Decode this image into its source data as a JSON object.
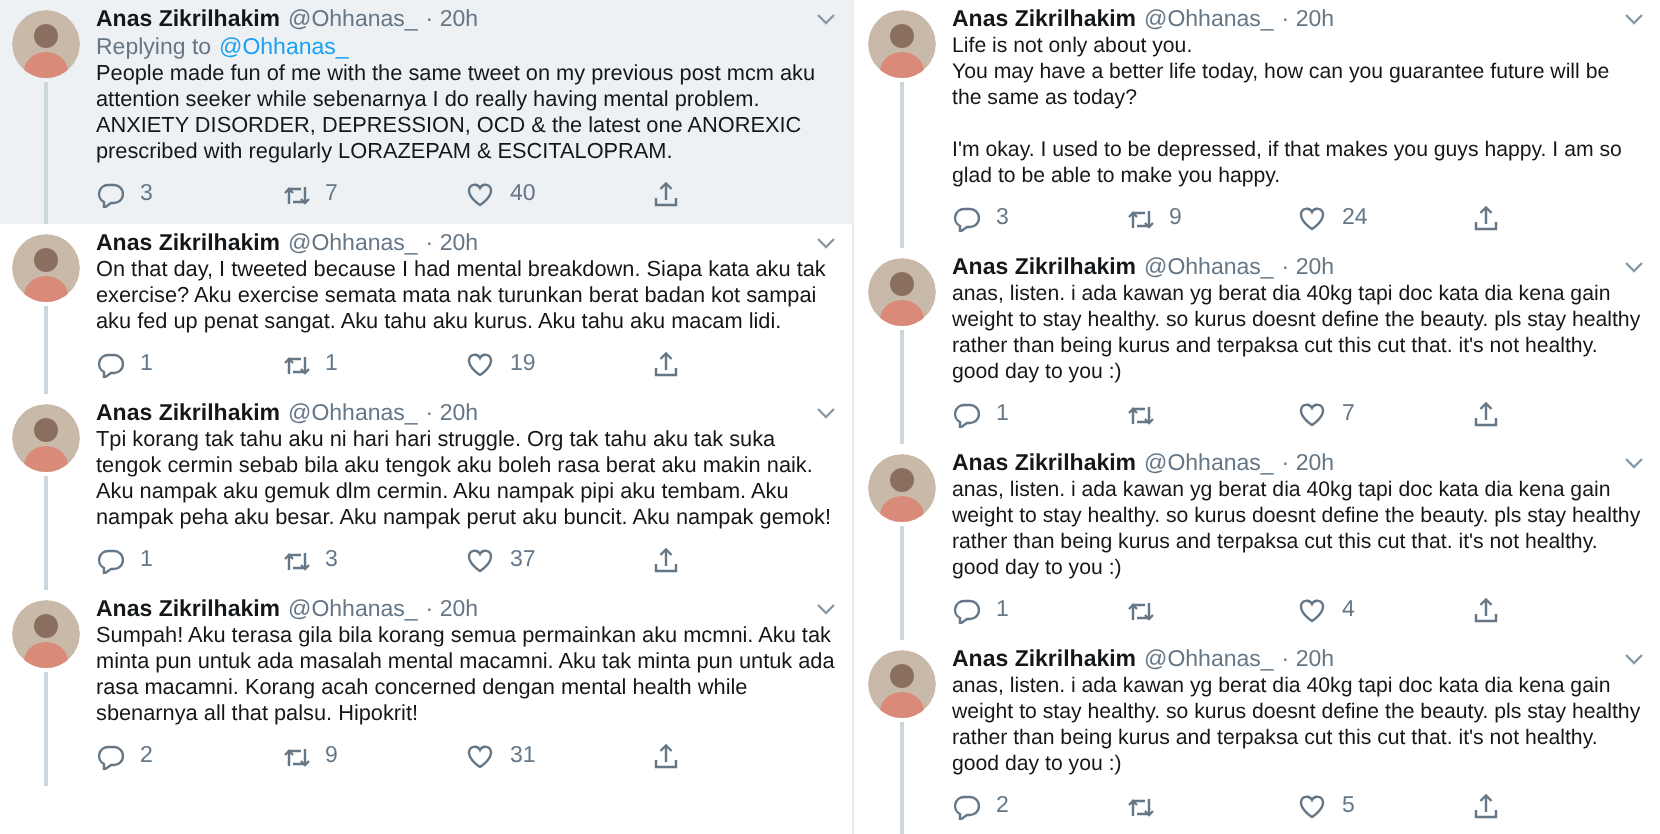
{
  "columns": [
    {
      "tweets": [
        {
          "name": "Anas Zikrilhakim",
          "handle": "@Ohhanas_",
          "time": "· 20h",
          "highlighted": true,
          "replying_to": {
            "label": "Replying to",
            "handle": "@Ohhanas_"
          },
          "text": "People made fun of me with the same tweet on my previous post mcm aku attention seeker while sebenarnya I do really having mental problem. ANXIETY DISORDER, DEPRESSION, OCD & the latest one ANOREXIC prescribed with regularly LORAZEPAM & ESCITALOPRAM.",
          "replies": "3",
          "retweets": "7",
          "likes": "40"
        },
        {
          "name": "Anas Zikrilhakim",
          "handle": "@Ohhanas_",
          "time": "· 20h",
          "highlighted": false,
          "text": "On that day, I tweeted because I had mental breakdown. Siapa kata aku tak exercise? Aku exercise semata mata nak turunkan berat badan kot sampai aku fed up penat sangat. Aku tahu aku kurus. Aku tahu aku macam lidi.",
          "replies": "1",
          "retweets": "1",
          "likes": "19"
        },
        {
          "name": "Anas Zikrilhakim",
          "handle": "@Ohhanas_",
          "time": "· 20h",
          "highlighted": false,
          "text": "Tpi korang tak tahu aku ni hari hari struggle. Org tak tahu aku tak suka tengok cermin sebab bila aku tengok aku boleh rasa berat aku makin naik. Aku nampak aku gemuk dlm cermin. Aku nampak pipi aku tembam. Aku nampak peha aku besar. Aku nampak perut aku buncit. Aku nampak gemok!",
          "replies": "1",
          "retweets": "3",
          "likes": "37"
        },
        {
          "name": "Anas Zikrilhakim",
          "handle": "@Ohhanas_",
          "time": "· 20h",
          "highlighted": false,
          "text": "Sumpah! Aku terasa gila bila korang semua permainkan aku mcmni. Aku tak minta pun untuk ada masalah mental macamni. Aku tak minta pun untuk ada rasa macamni. Korang acah concerned dengan mental health while sbenarnya all that palsu. Hipokrit!",
          "replies": "2",
          "retweets": "9",
          "likes": "31"
        }
      ]
    },
    {
      "tweets": [
        {
          "name": "Anas Zikrilhakim",
          "handle": "@Ohhanas_",
          "time": "· 20h",
          "highlighted": false,
          "text": "Life is not only about you.\nYou may have a better life today, how can you guarantee future will be the same as today?\n\nI'm okay. I used to be depressed, if that makes you guys happy. I am so glad to be able to make you happy.",
          "replies": "3",
          "retweets": "9",
          "likes": "24"
        },
        {
          "name": "Anas Zikrilhakim",
          "handle": "@Ohhanas_",
          "time": "· 20h",
          "highlighted": false,
          "text": "anas, listen. i ada kawan yg berat dia 40kg tapi doc kata dia kena gain weight to stay healthy. so kurus doesnt define the beauty. pls stay healthy rather than being kurus and terpaksa cut this cut that. it's not healthy. good day to you :)",
          "replies": "1",
          "likes": "7"
        },
        {
          "name": "Anas Zikrilhakim",
          "handle": "@Ohhanas_",
          "time": "· 20h",
          "highlighted": false,
          "text": "anas, listen. i ada kawan yg berat dia 40kg tapi doc kata dia kena gain weight to stay healthy. so kurus doesnt define the beauty. pls stay healthy rather than being kurus and terpaksa cut this cut that. it's not healthy. good day to you :)",
          "replies": "1",
          "likes": "4"
        },
        {
          "name": "Anas Zikrilhakim",
          "handle": "@Ohhanas_",
          "time": "· 20h",
          "highlighted": false,
          "text": "anas, listen. i ada kawan yg berat dia 40kg tapi doc kata dia kena gain weight to stay healthy. so kurus doesnt define the beauty. pls stay healthy rather than being kurus and terpaksa cut this cut that. it's not healthy. good day to you :)",
          "replies": "2",
          "likes": "5"
        }
      ]
    }
  ]
}
